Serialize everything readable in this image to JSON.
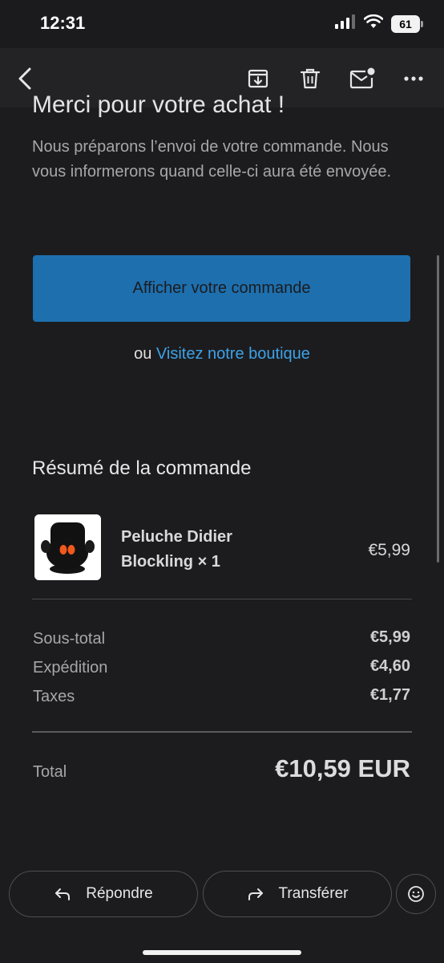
{
  "status": {
    "time": "12:31",
    "battery": "61",
    "icons": [
      "cellular-signal-icon",
      "wifi-icon",
      "battery-icon"
    ]
  },
  "toolbar": {
    "icons": [
      "back-chevron-icon",
      "archive-icon",
      "trash-icon",
      "mark-unread-icon",
      "more-icon"
    ]
  },
  "email": {
    "headline": "Merci pour votre achat !",
    "intro": "Nous préparons l’envoi de votre commande. Nous vous informerons quand celle-ci aura été envoyée.",
    "primary_button": "Afficher votre commande",
    "alt_prefix": "ou",
    "alt_link": "Visitez notre boutique",
    "summary_title": "Résumé de la commande",
    "item": {
      "name": "Peluche Didier Blockling × 1",
      "price": "€5,99"
    },
    "lines": [
      {
        "label": "Sous-total",
        "value": "€5,99"
      },
      {
        "label": "Expédition",
        "value": "€4,60"
      },
      {
        "label": "Taxes",
        "value": "€1,77"
      }
    ],
    "total_label": "Total",
    "total_value": "€10,59 EUR"
  },
  "actions": {
    "reply": "Répondre",
    "forward": "Transférer",
    "icons": [
      "reply-icon",
      "forward-icon",
      "emoji-icon"
    ]
  },
  "colors": {
    "background": "#1c1c1e",
    "primary_button": "#1e6fae",
    "link": "#3da2e8"
  }
}
